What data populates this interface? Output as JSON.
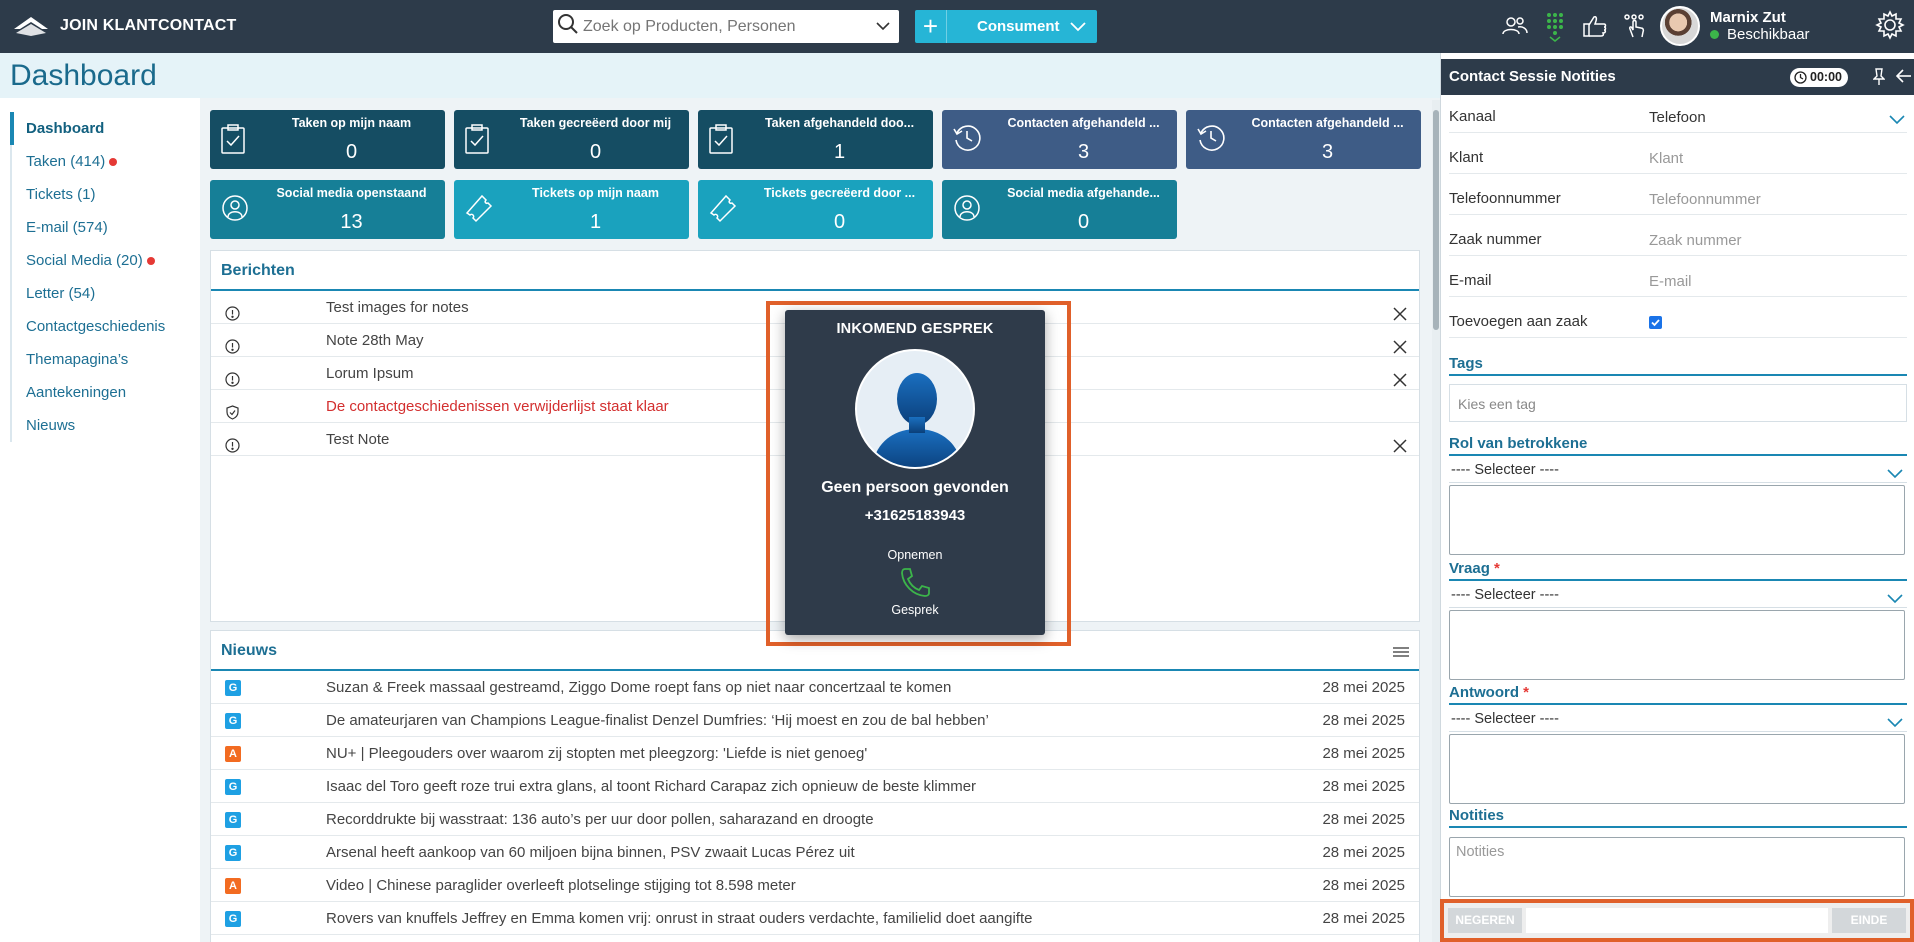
{
  "app": {
    "title": "JOIN KLANTCONTACT"
  },
  "search": {
    "placeholder": "Zoek op Producten, Personen"
  },
  "context_button": {
    "label": "Consument"
  },
  "user": {
    "name": "Marnix Zut",
    "status": "Beschikbaar",
    "status_color": "#3cb54a"
  },
  "page": {
    "title": "Dashboard"
  },
  "sidebar": {
    "items": [
      {
        "label": "Dashboard",
        "active": true,
        "alert": false
      },
      {
        "label": "Taken (414)",
        "alert": true
      },
      {
        "label": "Tickets (1)",
        "alert": false
      },
      {
        "label": "E-mail (574)",
        "alert": false
      },
      {
        "label": "Social Media (20)",
        "alert": true
      },
      {
        "label": "Letter (54)",
        "alert": false
      },
      {
        "label": "Contactgeschiedenis",
        "alert": false
      },
      {
        "label": "Themapagina’s",
        "alert": false
      },
      {
        "label": "Aantekeningen",
        "alert": false
      },
      {
        "label": "Nieuws",
        "alert": false
      }
    ]
  },
  "tiles": [
    {
      "title": "Taken op mijn naam",
      "value": "0",
      "icon": "clipboard-check-icon",
      "color": "#154d63"
    },
    {
      "title": "Taken gecreëerd door mij",
      "value": "0",
      "icon": "clipboard-check-icon",
      "color": "#154d63"
    },
    {
      "title": "Taken afgehandeld doo...",
      "value": "1",
      "icon": "clipboard-check-icon",
      "color": "#154d63"
    },
    {
      "title": "Contacten afgehandeld ...",
      "value": "3",
      "icon": "history-icon",
      "color": "#3e5c86"
    },
    {
      "title": "Contacten afgehandeld ...",
      "value": "3",
      "icon": "history-icon",
      "color": "#3e5c86"
    },
    {
      "title": "Social media openstaand",
      "value": "13",
      "icon": "social-network-icon",
      "color": "#167f97"
    },
    {
      "title": "Tickets op mijn naam",
      "value": "1",
      "icon": "ticket-icon",
      "color": "#1aa2be"
    },
    {
      "title": "Tickets gecreëerd door ...",
      "value": "0",
      "icon": "ticket-icon",
      "color": "#1aa2be"
    },
    {
      "title": "Social media afgehande...",
      "value": "0",
      "icon": "social-network-icon",
      "color": "#167f97"
    }
  ],
  "messages": {
    "title": "Berichten",
    "rows": [
      {
        "text": "Test images for notes",
        "closable": true,
        "highlight": false
      },
      {
        "text": "Note 28th May",
        "closable": true,
        "highlight": false
      },
      {
        "text": "Lorum Ipsum",
        "closable": true,
        "highlight": false
      },
      {
        "text": "De contactgeschiedenissen verwijderlijst staat klaar",
        "closable": false,
        "highlight": true
      },
      {
        "text": "Test Note",
        "closable": true,
        "highlight": false
      }
    ]
  },
  "news": {
    "title": "Nieuws",
    "rows": [
      {
        "source": "G",
        "title": "Suzan & Freek massaal gestreamd, Ziggo Dome roept fans op niet naar concertzaal te komen",
        "date": "28 mei 2025"
      },
      {
        "source": "G",
        "title": "De amateurjaren van Champions League-finalist Denzel Dumfries: ‘Hij moest en zou de bal hebben’",
        "date": "28 mei 2025"
      },
      {
        "source": "A",
        "title": "NU+ | Pleegouders over waarom zij stopten met pleegzorg: 'Liefde is niet genoeg'",
        "date": "28 mei 2025"
      },
      {
        "source": "G",
        "title": "Isaac del Toro geeft roze trui extra glans, al toont Richard Carapaz zich opnieuw de beste klimmer",
        "date": "28 mei 2025"
      },
      {
        "source": "G",
        "title": "Recorddrukte bij wasstraat: 136 auto’s per uur door pollen, saharazand en droogte",
        "date": "28 mei 2025"
      },
      {
        "source": "G",
        "title": "Arsenal heeft aankoop van 60 miljoen bijna binnen, PSV zwaait Lucas Pérez uit",
        "date": "28 mei 2025"
      },
      {
        "source": "A",
        "title": "Video | Chinese paraglider overleeft plotselinge stijging tot 8.598 meter",
        "date": "28 mei 2025"
      },
      {
        "source": "G",
        "title": "Rovers van knuffels Jeffrey en Emma komen vrij: onrust in straat ouders verdachte, familielid doet aangifte",
        "date": "28 mei 2025"
      }
    ]
  },
  "incoming_call": {
    "title": "INKOMEND GESPREK",
    "name": "Geen persoon gevonden",
    "phone": "+31625183943",
    "action_top": "Opnemen",
    "action_bottom": "Gesprek"
  },
  "contact_panel": {
    "title": "Contact Sessie Notities",
    "timer": "00:00",
    "fields": [
      {
        "label": "Kanaal",
        "value": "Telefoon",
        "placeholder": "",
        "dropdown": true
      },
      {
        "label": "Klant",
        "value": "",
        "placeholder": "Klant"
      },
      {
        "label": "Telefoonnummer",
        "value": "",
        "placeholder": "Telefoonnummer"
      },
      {
        "label": "Zaak nummer",
        "value": "",
        "placeholder": "Zaak nummer"
      },
      {
        "label": "E-mail",
        "value": "",
        "placeholder": "E-mail"
      }
    ],
    "add_to_case": {
      "label": "Toevoegen aan zaak",
      "checked": true
    },
    "tags": {
      "title": "Tags",
      "placeholder": "Kies een tag"
    },
    "role": {
      "title": "Rol van betrokkene",
      "selected": "---- Selecteer ----"
    },
    "question": {
      "title": "Vraag",
      "required_mark": "*",
      "selected": "---- Selecteer ----"
    },
    "answer": {
      "title": "Antwoord",
      "required_mark": "*",
      "selected": "---- Selecteer ----"
    },
    "notes": {
      "title": "Notities",
      "placeholder": "Notities"
    },
    "footer": {
      "ignore": "NEGEREN",
      "end": "EINDE"
    }
  }
}
